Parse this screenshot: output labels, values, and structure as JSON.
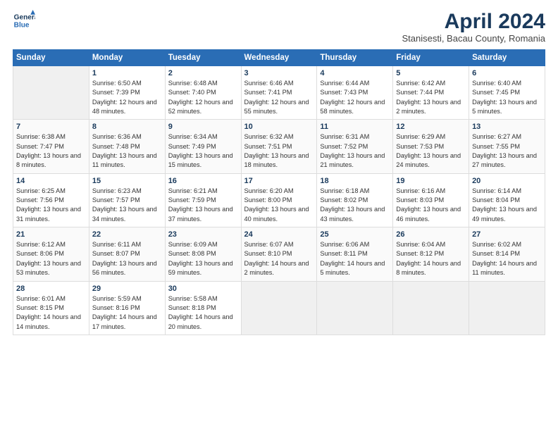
{
  "logo": {
    "line1": "General",
    "line2": "Blue"
  },
  "title": "April 2024",
  "subtitle": "Stanisesti, Bacau County, Romania",
  "days_header": [
    "Sunday",
    "Monday",
    "Tuesday",
    "Wednesday",
    "Thursday",
    "Friday",
    "Saturday"
  ],
  "weeks": [
    [
      {
        "num": "",
        "sunrise": "",
        "sunset": "",
        "daylight": ""
      },
      {
        "num": "1",
        "sunrise": "Sunrise: 6:50 AM",
        "sunset": "Sunset: 7:39 PM",
        "daylight": "Daylight: 12 hours and 48 minutes."
      },
      {
        "num": "2",
        "sunrise": "Sunrise: 6:48 AM",
        "sunset": "Sunset: 7:40 PM",
        "daylight": "Daylight: 12 hours and 52 minutes."
      },
      {
        "num": "3",
        "sunrise": "Sunrise: 6:46 AM",
        "sunset": "Sunset: 7:41 PM",
        "daylight": "Daylight: 12 hours and 55 minutes."
      },
      {
        "num": "4",
        "sunrise": "Sunrise: 6:44 AM",
        "sunset": "Sunset: 7:43 PM",
        "daylight": "Daylight: 12 hours and 58 minutes."
      },
      {
        "num": "5",
        "sunrise": "Sunrise: 6:42 AM",
        "sunset": "Sunset: 7:44 PM",
        "daylight": "Daylight: 13 hours and 2 minutes."
      },
      {
        "num": "6",
        "sunrise": "Sunrise: 6:40 AM",
        "sunset": "Sunset: 7:45 PM",
        "daylight": "Daylight: 13 hours and 5 minutes."
      }
    ],
    [
      {
        "num": "7",
        "sunrise": "Sunrise: 6:38 AM",
        "sunset": "Sunset: 7:47 PM",
        "daylight": "Daylight: 13 hours and 8 minutes."
      },
      {
        "num": "8",
        "sunrise": "Sunrise: 6:36 AM",
        "sunset": "Sunset: 7:48 PM",
        "daylight": "Daylight: 13 hours and 11 minutes."
      },
      {
        "num": "9",
        "sunrise": "Sunrise: 6:34 AM",
        "sunset": "Sunset: 7:49 PM",
        "daylight": "Daylight: 13 hours and 15 minutes."
      },
      {
        "num": "10",
        "sunrise": "Sunrise: 6:32 AM",
        "sunset": "Sunset: 7:51 PM",
        "daylight": "Daylight: 13 hours and 18 minutes."
      },
      {
        "num": "11",
        "sunrise": "Sunrise: 6:31 AM",
        "sunset": "Sunset: 7:52 PM",
        "daylight": "Daylight: 13 hours and 21 minutes."
      },
      {
        "num": "12",
        "sunrise": "Sunrise: 6:29 AM",
        "sunset": "Sunset: 7:53 PM",
        "daylight": "Daylight: 13 hours and 24 minutes."
      },
      {
        "num": "13",
        "sunrise": "Sunrise: 6:27 AM",
        "sunset": "Sunset: 7:55 PM",
        "daylight": "Daylight: 13 hours and 27 minutes."
      }
    ],
    [
      {
        "num": "14",
        "sunrise": "Sunrise: 6:25 AM",
        "sunset": "Sunset: 7:56 PM",
        "daylight": "Daylight: 13 hours and 31 minutes."
      },
      {
        "num": "15",
        "sunrise": "Sunrise: 6:23 AM",
        "sunset": "Sunset: 7:57 PM",
        "daylight": "Daylight: 13 hours and 34 minutes."
      },
      {
        "num": "16",
        "sunrise": "Sunrise: 6:21 AM",
        "sunset": "Sunset: 7:59 PM",
        "daylight": "Daylight: 13 hours and 37 minutes."
      },
      {
        "num": "17",
        "sunrise": "Sunrise: 6:20 AM",
        "sunset": "Sunset: 8:00 PM",
        "daylight": "Daylight: 13 hours and 40 minutes."
      },
      {
        "num": "18",
        "sunrise": "Sunrise: 6:18 AM",
        "sunset": "Sunset: 8:02 PM",
        "daylight": "Daylight: 13 hours and 43 minutes."
      },
      {
        "num": "19",
        "sunrise": "Sunrise: 6:16 AM",
        "sunset": "Sunset: 8:03 PM",
        "daylight": "Daylight: 13 hours and 46 minutes."
      },
      {
        "num": "20",
        "sunrise": "Sunrise: 6:14 AM",
        "sunset": "Sunset: 8:04 PM",
        "daylight": "Daylight: 13 hours and 49 minutes."
      }
    ],
    [
      {
        "num": "21",
        "sunrise": "Sunrise: 6:12 AM",
        "sunset": "Sunset: 8:06 PM",
        "daylight": "Daylight: 13 hours and 53 minutes."
      },
      {
        "num": "22",
        "sunrise": "Sunrise: 6:11 AM",
        "sunset": "Sunset: 8:07 PM",
        "daylight": "Daylight: 13 hours and 56 minutes."
      },
      {
        "num": "23",
        "sunrise": "Sunrise: 6:09 AM",
        "sunset": "Sunset: 8:08 PM",
        "daylight": "Daylight: 13 hours and 59 minutes."
      },
      {
        "num": "24",
        "sunrise": "Sunrise: 6:07 AM",
        "sunset": "Sunset: 8:10 PM",
        "daylight": "Daylight: 14 hours and 2 minutes."
      },
      {
        "num": "25",
        "sunrise": "Sunrise: 6:06 AM",
        "sunset": "Sunset: 8:11 PM",
        "daylight": "Daylight: 14 hours and 5 minutes."
      },
      {
        "num": "26",
        "sunrise": "Sunrise: 6:04 AM",
        "sunset": "Sunset: 8:12 PM",
        "daylight": "Daylight: 14 hours and 8 minutes."
      },
      {
        "num": "27",
        "sunrise": "Sunrise: 6:02 AM",
        "sunset": "Sunset: 8:14 PM",
        "daylight": "Daylight: 14 hours and 11 minutes."
      }
    ],
    [
      {
        "num": "28",
        "sunrise": "Sunrise: 6:01 AM",
        "sunset": "Sunset: 8:15 PM",
        "daylight": "Daylight: 14 hours and 14 minutes."
      },
      {
        "num": "29",
        "sunrise": "Sunrise: 5:59 AM",
        "sunset": "Sunset: 8:16 PM",
        "daylight": "Daylight: 14 hours and 17 minutes."
      },
      {
        "num": "30",
        "sunrise": "Sunrise: 5:58 AM",
        "sunset": "Sunset: 8:18 PM",
        "daylight": "Daylight: 14 hours and 20 minutes."
      },
      {
        "num": "",
        "sunrise": "",
        "sunset": "",
        "daylight": ""
      },
      {
        "num": "",
        "sunrise": "",
        "sunset": "",
        "daylight": ""
      },
      {
        "num": "",
        "sunrise": "",
        "sunset": "",
        "daylight": ""
      },
      {
        "num": "",
        "sunrise": "",
        "sunset": "",
        "daylight": ""
      }
    ]
  ]
}
